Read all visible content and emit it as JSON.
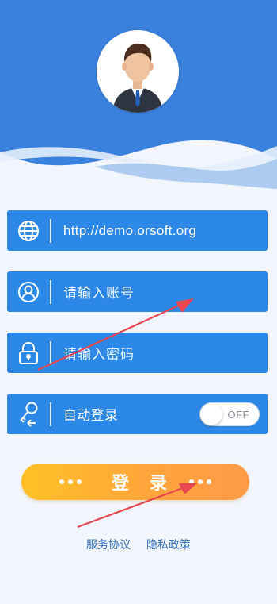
{
  "header": {
    "avatar_alt": "user avatar"
  },
  "fields": {
    "server": {
      "value": "http://demo.orsoft.org",
      "icon": "globe-icon"
    },
    "account": {
      "placeholder": "请输入账号",
      "icon": "user-icon"
    },
    "password": {
      "placeholder": "请输入密码",
      "icon": "lock-icon"
    },
    "auto_login": {
      "label": "自动登录",
      "toggle_text": "OFF",
      "icon": "key-icon"
    }
  },
  "login_button": {
    "label": "登 录"
  },
  "links": {
    "service": "服务协议",
    "privacy": "隐私政策"
  },
  "colors": {
    "header_blue": "#3b82de",
    "field_blue": "#2b88e6",
    "button_gradient_start": "#ffc126",
    "button_gradient_end": "#ff9a48",
    "link": "#2f6fbf",
    "arrow": "#e8474f"
  }
}
